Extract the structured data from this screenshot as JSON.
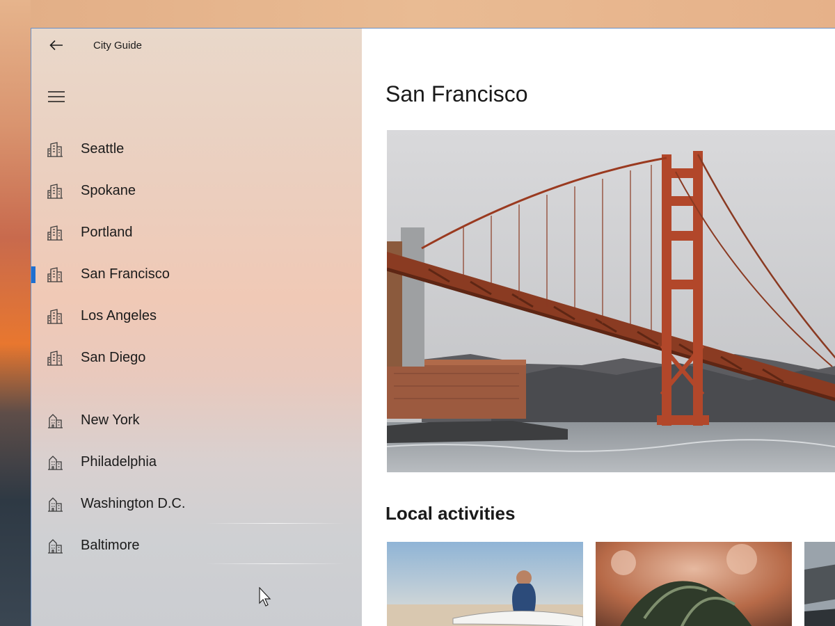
{
  "app": {
    "title": "City Guide"
  },
  "nav": {
    "items": [
      {
        "label": "Seattle",
        "icon": "city-icon"
      },
      {
        "label": "Spokane",
        "icon": "city-icon"
      },
      {
        "label": "Portland",
        "icon": "city-icon"
      },
      {
        "label": "San Francisco",
        "icon": "city-icon",
        "selected": true
      },
      {
        "label": "Los Angeles",
        "icon": "city-icon"
      },
      {
        "label": "San Diego",
        "icon": "city-icon"
      },
      {
        "label": "New York",
        "icon": "building-icon"
      },
      {
        "label": "Philadelphia",
        "icon": "building-icon"
      },
      {
        "label": "Washington D.C.",
        "icon": "building-icon"
      },
      {
        "label": "Baltimore",
        "icon": "building-icon"
      }
    ]
  },
  "main": {
    "title": "San Francisco",
    "section_title": "Local activities"
  },
  "colors": {
    "accent": "#1f6fd0"
  }
}
